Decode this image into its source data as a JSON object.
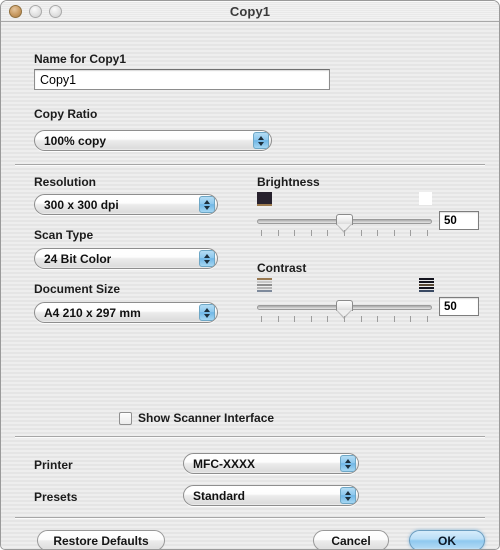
{
  "window": {
    "title": "Copy1",
    "traffic_lights": [
      "close-button",
      "minimize-button",
      "zoom-button"
    ]
  },
  "name_section": {
    "label": "Name for Copy1",
    "value": "Copy1",
    "placeholder": "Copy1"
  },
  "copy_ratio": {
    "label": "Copy Ratio",
    "value": "100% copy"
  },
  "resolution": {
    "label": "Resolution",
    "value": "300 x 300 dpi"
  },
  "scan_type": {
    "label": "Scan Type",
    "value": "24 Bit Color"
  },
  "document_size": {
    "label": "Document Size",
    "value": "A4  210 x 297 mm"
  },
  "brightness": {
    "label": "Brightness",
    "value": "50",
    "slider_percent": 50,
    "tick_count": 11,
    "icon_low": "dark-square-icon",
    "icon_high": "light-square-icon"
  },
  "contrast": {
    "label": "Contrast",
    "value": "50",
    "slider_percent": 50,
    "tick_count": 11,
    "icon_low": "low-contrast-icon",
    "icon_high": "high-contrast-icon"
  },
  "show_scanner_interface": {
    "label": "Show Scanner Interface",
    "checked": false
  },
  "printer": {
    "label": "Printer",
    "value_prefix": "MFC-",
    "value_suffix": "XXXX"
  },
  "presets": {
    "label": "Presets",
    "value": "Standard"
  },
  "buttons": {
    "restore_defaults": "Restore Defaults",
    "cancel": "Cancel",
    "ok": "OK"
  },
  "colors": {
    "window_bg": "#ececec",
    "accent_blue": "#8fc9ef",
    "popup_arrow_blue": "#6fb6e6",
    "text": "#1c1c1c"
  }
}
